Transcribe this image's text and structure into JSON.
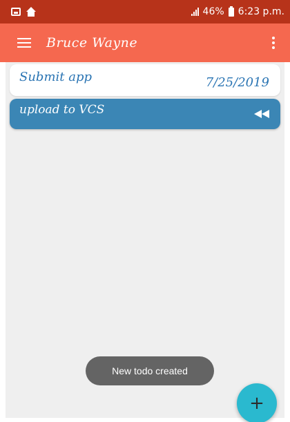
{
  "status_bar": {
    "left_icons": [
      "image-icon",
      "home-icon"
    ],
    "battery": "46%",
    "time": "6:23 p.m."
  },
  "app_bar": {
    "title": "Bruce Wayne",
    "menu_icon": "menu-icon",
    "overflow_icon": "more-vert-icon"
  },
  "todos": [
    {
      "title": "Submit app",
      "date": "7/25/2019"
    },
    {
      "title": "upload to VCS",
      "icon": "rewind-icon"
    }
  ],
  "toast": {
    "message": "New todo created"
  },
  "fab": {
    "label": "+",
    "icon": "plus-icon"
  },
  "colors": {
    "status_bar": "#b7331a",
    "app_bar": "#f5684f",
    "card_text": "#2a74b3",
    "card_selected": "#3b86b5",
    "fab": "#2ab9cf",
    "toast": "#646464"
  }
}
